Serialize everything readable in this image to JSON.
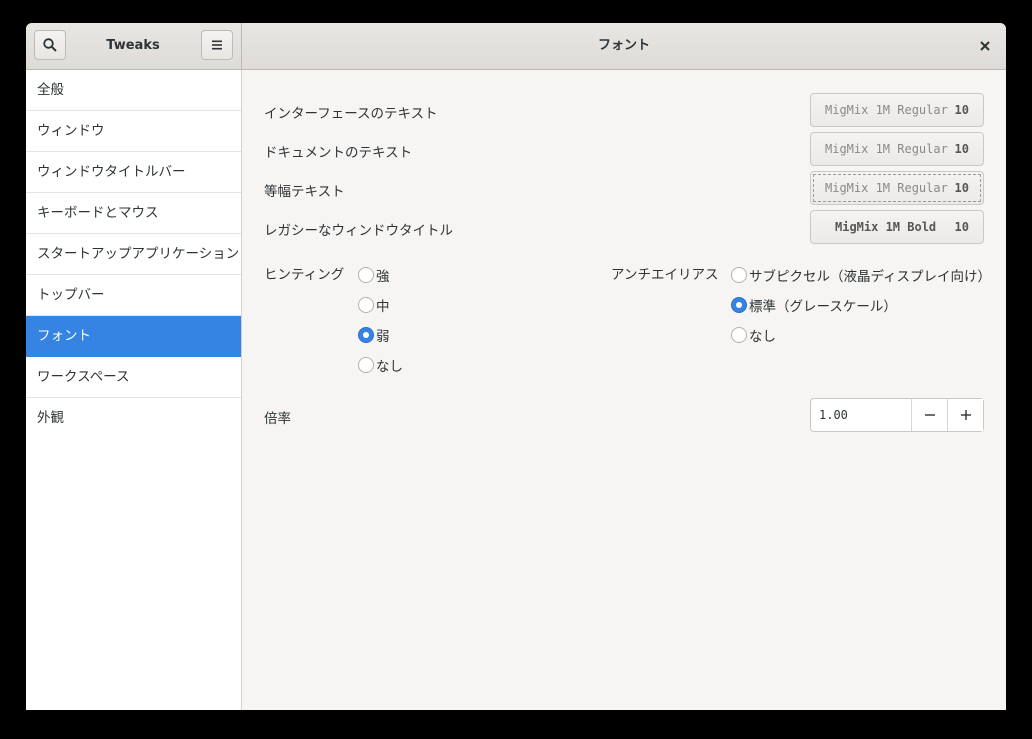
{
  "app": {
    "title": "Tweaks"
  },
  "header": {
    "page_title": "フォント"
  },
  "sidebar": {
    "items": [
      {
        "label": "全般"
      },
      {
        "label": "ウィンドウ"
      },
      {
        "label": "ウィンドウタイトルバー"
      },
      {
        "label": "キーボードとマウス"
      },
      {
        "label": "スタートアップアプリケーション"
      },
      {
        "label": "トップバー"
      },
      {
        "label": "フォント",
        "active": true
      },
      {
        "label": "ワークスペース"
      },
      {
        "label": "外観"
      }
    ]
  },
  "fonts": {
    "interface": {
      "label": "インターフェースのテキスト",
      "font": "MigMix 1M Regular",
      "size": "10"
    },
    "document": {
      "label": "ドキュメントのテキスト",
      "font": "MigMix 1M Regular",
      "size": "10"
    },
    "monospace": {
      "label": "等幅テキスト",
      "font": "MigMix 1M Regular",
      "size": "10"
    },
    "legacy_title": {
      "label": "レガシーなウィンドウタイトル",
      "font": "MigMix 1M Bold",
      "size": "10"
    }
  },
  "hinting": {
    "label": "ヒンティング",
    "options": [
      "強",
      "中",
      "弱",
      "なし"
    ],
    "selected": "弱"
  },
  "antialiasing": {
    "label": "アンチエイリアス",
    "options": [
      "サブピクセル（液晶ディスプレイ向け）",
      "標準（グレースケール）",
      "なし"
    ],
    "selected": "標準（グレースケール）"
  },
  "scaling": {
    "label": "倍率",
    "value": "1.00",
    "decrement": "−",
    "increment": "+"
  },
  "colors": {
    "accent": "#3584e4",
    "header_bg": "#e8e6e3",
    "content_bg": "#f6f5f4"
  },
  "icons": {
    "search": "search-icon",
    "menu": "hamburger-menu-icon",
    "close": "close-icon"
  }
}
